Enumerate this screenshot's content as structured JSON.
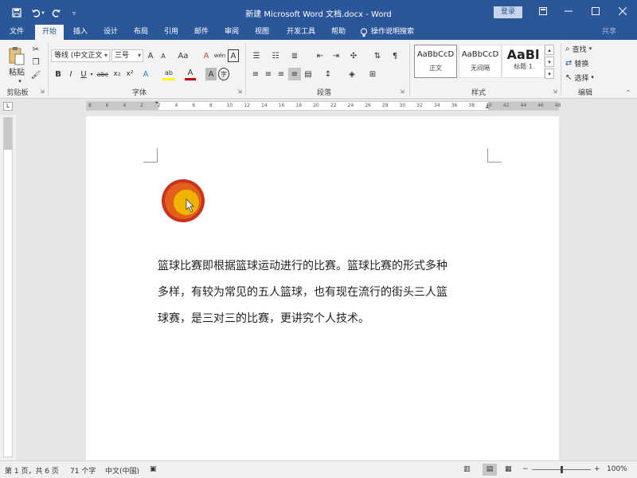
{
  "title_bar": {
    "title": "新建 Microsoft Word 文档.docx  -  Word",
    "login": "登录",
    "ribbon_display_icon": "ribbon-display-icon",
    "minimize_icon": "minimize-icon",
    "maximize_icon": "maximize-icon",
    "close_icon": "close-icon"
  },
  "quick_access": {
    "save_icon": "save-icon",
    "undo_icon": "undo-icon",
    "redo_icon": "redo-icon",
    "customize_icon": "customize-icon"
  },
  "tabs": [
    {
      "label": "文件",
      "active": false
    },
    {
      "label": "开始",
      "active": true
    },
    {
      "label": "插入",
      "active": false
    },
    {
      "label": "设计",
      "active": false
    },
    {
      "label": "布局",
      "active": false
    },
    {
      "label": "引用",
      "active": false
    },
    {
      "label": "邮件",
      "active": false
    },
    {
      "label": "审阅",
      "active": false
    },
    {
      "label": "视图",
      "active": false
    },
    {
      "label": "开发工具",
      "active": false
    },
    {
      "label": "帮助",
      "active": false
    }
  ],
  "help_search": "操作说明搜索",
  "share": "共享",
  "ribbon": {
    "clipboard": {
      "label": "剪贴板",
      "paste": "粘贴"
    },
    "font": {
      "label": "字体",
      "font_name": "等线 (中文正文",
      "font_size": "三号",
      "grow": "A",
      "shrink": "A",
      "change_case": "Aa",
      "clear_format": "A",
      "phonetic": "wén",
      "char_border": "A",
      "bold": "B",
      "italic": "I",
      "underline": "U",
      "strike": "abc",
      "subscript": "x₂",
      "superscript": "x²",
      "text_effect": "A",
      "highlight": "ab",
      "font_color": "A",
      "char_shading": "A",
      "enclose": "字"
    },
    "paragraph": {
      "label": "段落"
    },
    "styles": {
      "label": "样式",
      "items": [
        {
          "sample": "AaBbCcD",
          "name": "正文",
          "selected": true
        },
        {
          "sample": "AaBbCcD",
          "name": "无间隔",
          "selected": false
        },
        {
          "sample": "AaBl",
          "name": "标题 1",
          "selected": false
        }
      ]
    },
    "editing": {
      "label": "编辑",
      "find": "查找",
      "replace": "替换",
      "select": "选择"
    }
  },
  "ruler": {
    "h_ticks": [
      "8",
      "6",
      "4",
      "2",
      "2",
      "4",
      "6",
      "8",
      "10",
      "12",
      "14",
      "16",
      "18",
      "20",
      "22",
      "24",
      "26",
      "28",
      "30",
      "32",
      "34",
      "36",
      "38",
      "40",
      "42",
      "44",
      "46",
      "48"
    ],
    "corner": "L"
  },
  "document": {
    "paragraph_lines": [
      "篮球比赛即根据篮球运动进行的比赛。篮球比赛的形式多种",
      "多样，有较为常见的五人篮球，也有现在流行的街头三人篮",
      "球赛，是三对三的比赛，更讲究个人技术。"
    ]
  },
  "status_bar": {
    "page": "第 1 页，共 6 页",
    "words": "71 个字",
    "language": "中文(中国)",
    "zoom": "100%",
    "zoom_minus": "−",
    "zoom_plus": "+"
  },
  "colors": {
    "word_blue": "#2b579a",
    "ribbon_bg": "#f3f3f3",
    "doc_bg": "#e6e6e6",
    "font_color_red": "#c00000",
    "highlight_yellow": "#ffff00",
    "cursor_orange": "#f0b400",
    "cursor_red": "#c8321e"
  }
}
